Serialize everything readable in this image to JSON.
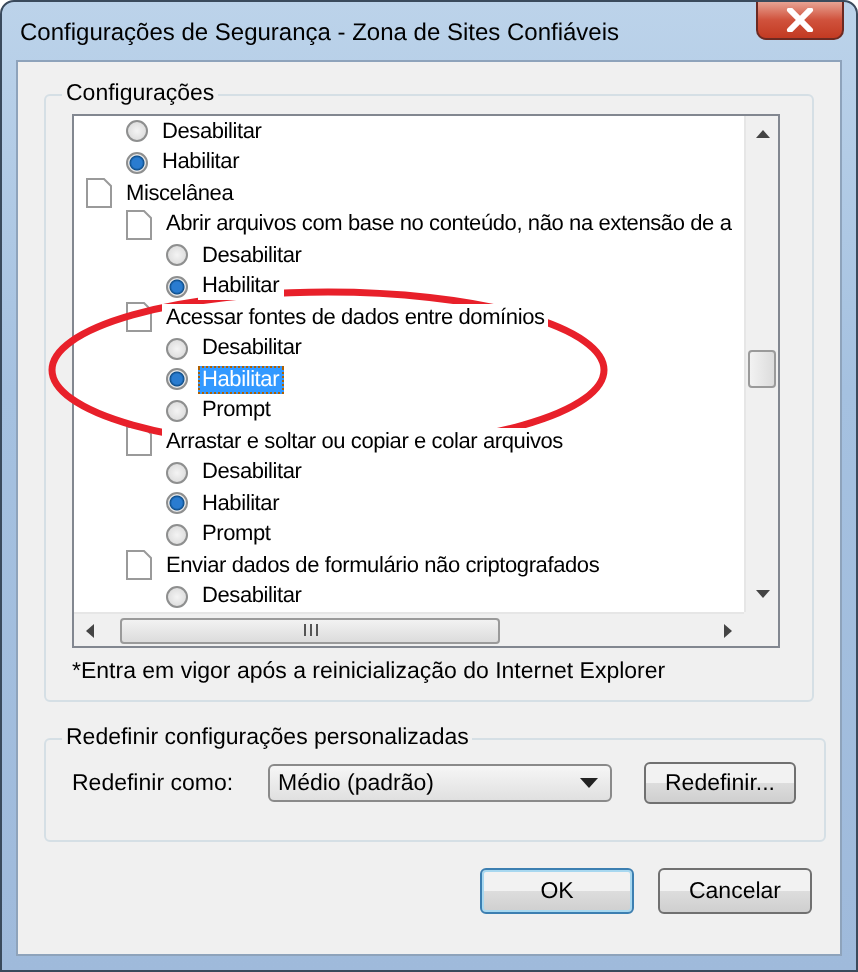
{
  "window": {
    "title": "Configurações de Segurança - Zona de Sites Confiáveis"
  },
  "settings_group": {
    "title": "Configurações",
    "tree": [
      {
        "kind": "option",
        "label": "Desabilitar",
        "checked": false,
        "focused": false
      },
      {
        "kind": "option",
        "label": "Habilitar",
        "checked": true,
        "focused": false
      },
      {
        "kind": "category",
        "label": "Miscelânea",
        "children": [
          {
            "kind": "setting",
            "label": "Abrir arquivos com base no conteúdo, não na extensão de a",
            "children": [
              {
                "kind": "option",
                "label": "Desabilitar",
                "checked": false,
                "focused": false
              },
              {
                "kind": "option",
                "label": "Habilitar",
                "checked": true,
                "focused": false
              }
            ]
          },
          {
            "kind": "setting",
            "label": "Acessar fontes de dados entre domínios",
            "children": [
              {
                "kind": "option",
                "label": "Desabilitar",
                "checked": false,
                "focused": false
              },
              {
                "kind": "option",
                "label": "Habilitar",
                "checked": true,
                "focused": true
              },
              {
                "kind": "option",
                "label": "Prompt",
                "checked": false,
                "focused": false
              }
            ]
          },
          {
            "kind": "setting",
            "label": "Arrastar e soltar ou copiar e colar arquivos",
            "children": [
              {
                "kind": "option",
                "label": "Desabilitar",
                "checked": false,
                "focused": false
              },
              {
                "kind": "option",
                "label": "Habilitar",
                "checked": true,
                "focused": false
              },
              {
                "kind": "option",
                "label": "Prompt",
                "checked": false,
                "focused": false
              }
            ]
          },
          {
            "kind": "setting",
            "label": "Enviar dados de formulário não criptografados",
            "children": [
              {
                "kind": "option",
                "label": "Desabilitar",
                "checked": false,
                "focused": false
              }
            ]
          }
        ]
      }
    ],
    "note": "*Entra em vigor após a reinicialização do Internet Explorer"
  },
  "reset_group": {
    "title": "Redefinir configurações personalizadas",
    "label": "Redefinir como:",
    "dropdown_value": "Médio (padrão)",
    "button": "Redefinir..."
  },
  "buttons": [
    "OK",
    "Cancelar"
  ]
}
